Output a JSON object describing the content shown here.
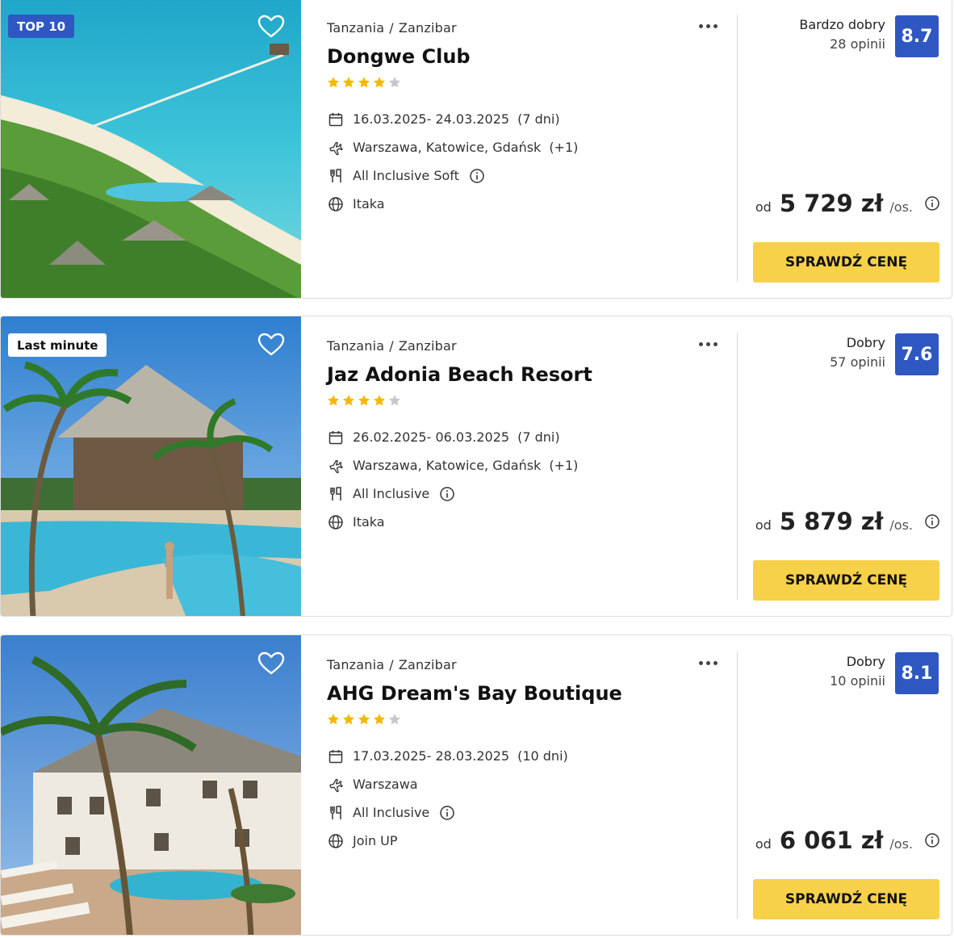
{
  "offers": [
    {
      "badge": "TOP 10",
      "location": {
        "country": "Tanzania",
        "separator": "/",
        "region": "Zanzibar"
      },
      "name": "Dongwe Club",
      "stars": 4,
      "dates": "16.03.2025- 24.03.2025",
      "duration": "(7 dni)",
      "departure": "Warszawa, Katowice, Gdańsk",
      "departure_extra": "(+1)",
      "board": "All Inclusive Soft",
      "operator": "Itaka",
      "rating_label": "Bardzo dobry",
      "rating_count": "28 opinii",
      "score": "8.7",
      "price_prefix": "od",
      "price": "5 729 zł",
      "price_suffix": "/os.",
      "cta": "SPRAWDŹ CENĘ"
    },
    {
      "badge": "Last minute",
      "location": {
        "country": "Tanzania",
        "separator": "/",
        "region": "Zanzibar"
      },
      "name": "Jaz Adonia Beach Resort",
      "stars": 4,
      "dates": "26.02.2025- 06.03.2025",
      "duration": "(7 dni)",
      "departure": "Warszawa, Katowice, Gdańsk",
      "departure_extra": "(+1)",
      "board": "All Inclusive",
      "operator": "Itaka",
      "rating_label": "Dobry",
      "rating_count": "57 opinii",
      "score": "7.6",
      "price_prefix": "od",
      "price": "5 879 zł",
      "price_suffix": "/os.",
      "cta": "SPRAWDŹ CENĘ"
    },
    {
      "badge": "",
      "location": {
        "country": "Tanzania",
        "separator": "/",
        "region": "Zanzibar"
      },
      "name": "AHG Dream's Bay Boutique",
      "stars": 4,
      "dates": "17.03.2025- 28.03.2025",
      "duration": "(10 dni)",
      "departure": "Warszawa",
      "departure_extra": "",
      "board": "All Inclusive",
      "operator": "Join UP",
      "rating_label": "Dobry",
      "rating_count": "10 opinii",
      "score": "8.1",
      "price_prefix": "od",
      "price": "6 061 zł",
      "price_suffix": "/os.",
      "cta": "SPRAWDŹ CENĘ"
    }
  ],
  "icons": {
    "favorite": "heart-icon",
    "menu": "more-icon",
    "date": "calendar-icon",
    "flight": "plane-icon",
    "board": "cutlery-icon",
    "operator": "globe-icon",
    "info": "info-icon",
    "rating": "star-icon"
  },
  "colors": {
    "score_bg": "#2e57c2",
    "cta_bg": "#f7d14a",
    "star_filled": "#f5b800",
    "star_empty": "#c8c8c8"
  }
}
